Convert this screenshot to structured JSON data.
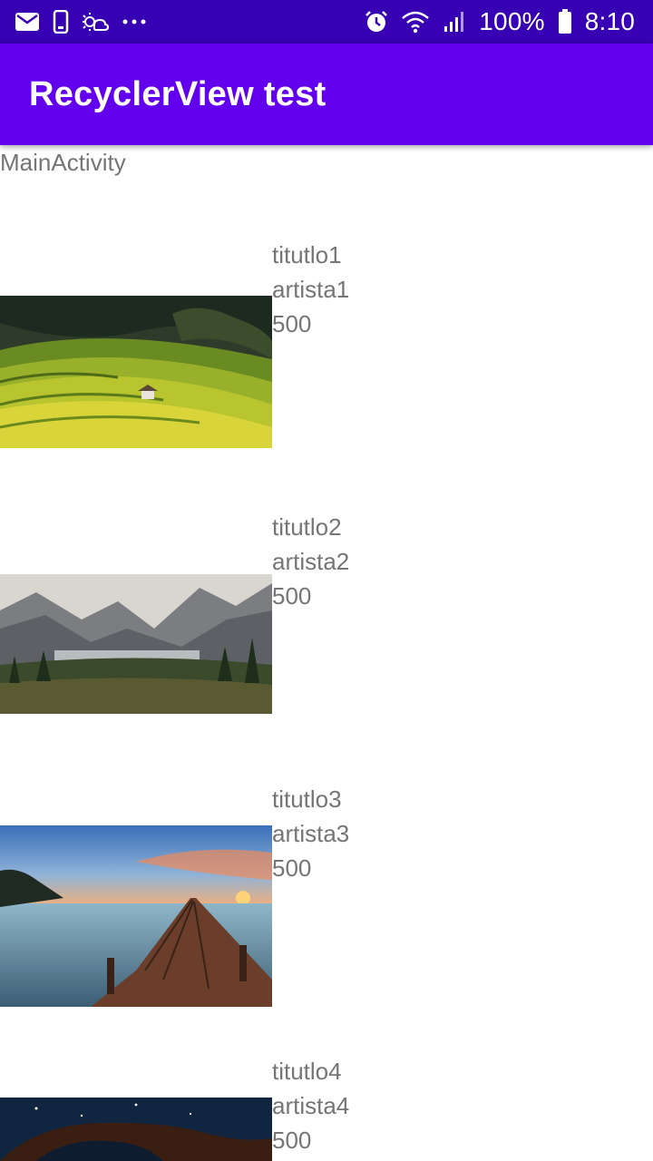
{
  "status_bar": {
    "left_icons": [
      "mail-icon",
      "phone-outline-icon",
      "weather-icon",
      "more-dots-icon"
    ],
    "right_icons": [
      "alarm-icon",
      "wifi-icon",
      "signal-icon",
      "battery-icon"
    ],
    "battery": "100%",
    "time": "8:10"
  },
  "app_bar": {
    "title": "RecyclerView test"
  },
  "main": {
    "activity_label": "MainActivity",
    "items": [
      {
        "title": "titutlo1",
        "artist": "artista1",
        "value": "500",
        "image": "terraced-rice-fields"
      },
      {
        "title": "titutlo2",
        "artist": "artista2",
        "value": "500",
        "image": "mountain-lake-valley"
      },
      {
        "title": "titutlo3",
        "artist": "artista3",
        "value": "500",
        "image": "pier-sunset-lake"
      },
      {
        "title": "titutlo4",
        "artist": "artista4",
        "value": "500",
        "image": "night-sky-rock-arch"
      }
    ]
  },
  "colors": {
    "status_bar": "#3700b3",
    "app_bar": "#6200ee",
    "text_secondary": "#757575"
  }
}
